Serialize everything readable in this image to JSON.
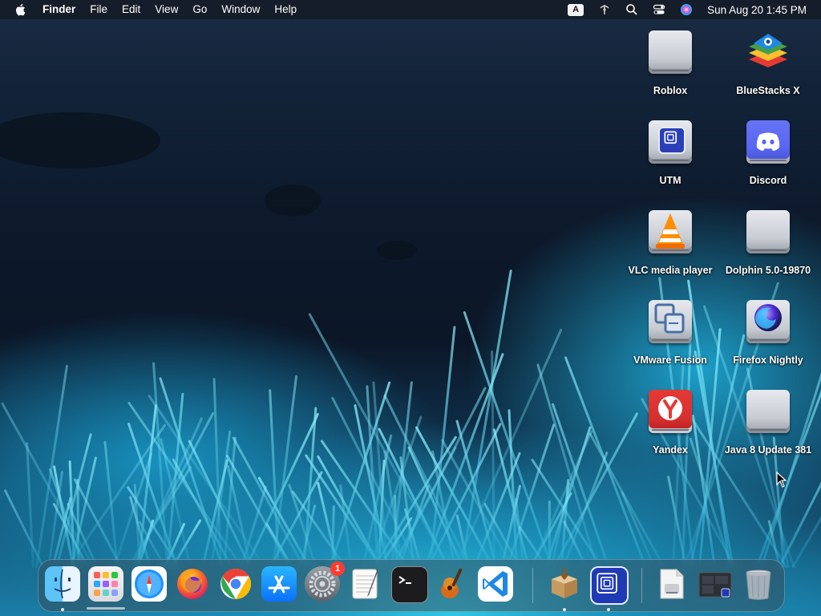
{
  "menubar": {
    "app_name": "Finder",
    "items": [
      "File",
      "Edit",
      "View",
      "Go",
      "Window",
      "Help"
    ],
    "input_source": "A",
    "clock": "Sun Aug 20  1:45 PM"
  },
  "desktop": {
    "icons": [
      {
        "label": "Roblox",
        "icon": "drive-icon"
      },
      {
        "label": "BlueStacks X",
        "icon": "bluestacks-icon"
      },
      {
        "label": "UTM",
        "icon": "utm-drive-icon"
      },
      {
        "label": "Discord",
        "icon": "discord-icon"
      },
      {
        "label": "VLC media player",
        "icon": "vlc-icon"
      },
      {
        "label": "Dolphin 5.0-19870",
        "icon": "drive-icon"
      },
      {
        "label": "VMware Fusion",
        "icon": "vmware-fusion-icon"
      },
      {
        "label": "Firefox Nightly",
        "icon": "firefox-nightly-icon"
      },
      {
        "label": "Yandex",
        "icon": "yandex-icon"
      },
      {
        "label": "Java 8 Update 381",
        "icon": "drive-icon"
      }
    ]
  },
  "dock": {
    "apps": [
      {
        "name": "finder-icon",
        "running": true
      },
      {
        "name": "launchpad-icon",
        "running": false
      },
      {
        "name": "safari-icon",
        "running": false
      },
      {
        "name": "firefox-icon",
        "running": false
      },
      {
        "name": "chrome-icon",
        "running": false
      },
      {
        "name": "app-store-icon",
        "running": false
      },
      {
        "name": "system-settings-icon",
        "running": false,
        "badge": "1"
      },
      {
        "name": "textedit-icon",
        "running": false
      },
      {
        "name": "terminal-icon",
        "running": false
      },
      {
        "name": "garageband-icon",
        "running": false
      },
      {
        "name": "vscode-icon",
        "running": false
      },
      {
        "name": "installer-icon",
        "running": true
      },
      {
        "name": "utm-icon",
        "running": true
      },
      {
        "name": "preview-document-icon",
        "running": false
      },
      {
        "name": "window-stack-icon",
        "running": false
      },
      {
        "name": "trash-icon",
        "running": false
      }
    ],
    "badge_system_settings": "1"
  },
  "colors": {
    "menubar_bg": "#141820",
    "discord": "#5865F2",
    "vscode": "#1E88E5",
    "badge": "#FF3B30"
  }
}
